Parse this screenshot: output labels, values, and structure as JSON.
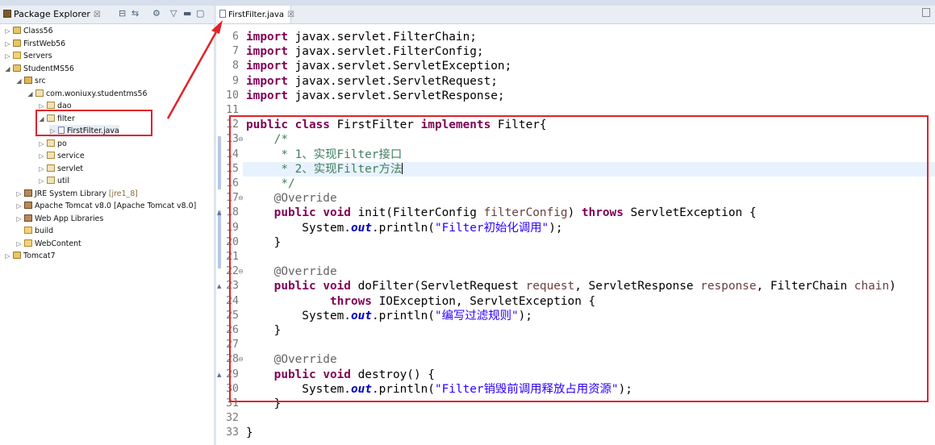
{
  "package_explorer": {
    "title": "Package Explorer",
    "close": "☒",
    "tree": [
      {
        "label": "Class56",
        "icon": "project-icon",
        "twisty": "▷",
        "indent": 0
      },
      {
        "label": "FirstWeb56",
        "icon": "project-icon",
        "twisty": "▷",
        "indent": 0
      },
      {
        "label": "Servers",
        "icon": "folder-icon",
        "twisty": "▷",
        "indent": 0
      },
      {
        "label": "StudentMS56",
        "icon": "project-icon",
        "twisty": "◢",
        "indent": 0
      },
      {
        "label": "src",
        "icon": "source-folder-icon",
        "twisty": "◢",
        "indent": 1
      },
      {
        "label": "com.woniuxy.studentms56",
        "icon": "package-icon",
        "twisty": "◢",
        "indent": 2
      },
      {
        "label": "dao",
        "icon": "package-icon",
        "twisty": "▷",
        "indent": 3
      },
      {
        "label": "filter",
        "icon": "package-icon",
        "twisty": "◢",
        "indent": 3
      },
      {
        "label": "FirstFilter.java",
        "icon": "java-file-icon",
        "twisty": "▷",
        "indent": 4
      },
      {
        "label": "po",
        "icon": "package-icon",
        "twisty": "▷",
        "indent": 3
      },
      {
        "label": "service",
        "icon": "package-icon",
        "twisty": "▷",
        "indent": 3
      },
      {
        "label": "servlet",
        "icon": "package-icon",
        "twisty": "▷",
        "indent": 3
      },
      {
        "label": "util",
        "icon": "package-icon",
        "twisty": "▷",
        "indent": 3
      },
      {
        "label": "JRE System Library",
        "suffix": "[jre1_8]",
        "icon": "library-icon",
        "twisty": "▷",
        "indent": 1
      },
      {
        "label": "Apache Tomcat v8.0 [Apache Tomcat v8.0]",
        "icon": "library-icon",
        "twisty": "▷",
        "indent": 1
      },
      {
        "label": "Web App Libraries",
        "icon": "library-icon",
        "twisty": "▷",
        "indent": 1
      },
      {
        "label": "build",
        "icon": "folder-icon",
        "twisty": "",
        "indent": 1
      },
      {
        "label": "WebContent",
        "icon": "folder-icon",
        "twisty": "▷",
        "indent": 1
      },
      {
        "label": "Tomcat7",
        "icon": "project-icon",
        "twisty": "▷",
        "indent": 0
      }
    ]
  },
  "editor": {
    "tab_label": "FirstFilter.java",
    "tab_close": "☒",
    "lines": [
      {
        "n": "6",
        "segs": [
          {
            "t": "import",
            "c": "kw"
          },
          {
            "t": " javax.servlet.FilterChain;"
          }
        ]
      },
      {
        "n": "7",
        "segs": [
          {
            "t": "import",
            "c": "kw"
          },
          {
            "t": " javax.servlet.FilterConfig;"
          }
        ]
      },
      {
        "n": "8",
        "segs": [
          {
            "t": "import",
            "c": "kw"
          },
          {
            "t": " javax.servlet.ServletException;"
          }
        ]
      },
      {
        "n": "9",
        "segs": [
          {
            "t": "import",
            "c": "kw"
          },
          {
            "t": " javax.servlet.ServletRequest;"
          }
        ]
      },
      {
        "n": "10",
        "segs": [
          {
            "t": "import",
            "c": "kw"
          },
          {
            "t": " javax.servlet.ServletResponse;"
          }
        ]
      },
      {
        "n": "11",
        "segs": []
      },
      {
        "n": "12",
        "segs": [
          {
            "t": "public",
            "c": "kw"
          },
          {
            "t": " "
          },
          {
            "t": "class",
            "c": "kw"
          },
          {
            "t": " FirstFilter "
          },
          {
            "t": "implements",
            "c": "kw"
          },
          {
            "t": " Filter{"
          }
        ]
      },
      {
        "n": "13",
        "fold": "⊖",
        "segs": [
          {
            "t": "    /*",
            "c": "cm"
          }
        ]
      },
      {
        "n": "14",
        "segs": [
          {
            "t": "     * 1、实现Filter接口",
            "c": "cm"
          }
        ]
      },
      {
        "n": "15",
        "segs": [
          {
            "t": "     * 2、实现Filter方法",
            "c": "cm"
          }
        ]
      },
      {
        "n": "16",
        "segs": [
          {
            "t": "     */",
            "c": "cm"
          }
        ]
      },
      {
        "n": "17",
        "fold": "⊖",
        "segs": [
          {
            "t": "    "
          },
          {
            "t": "@Override",
            "c": "an"
          }
        ]
      },
      {
        "n": "18",
        "ovr": "▲",
        "segs": [
          {
            "t": "    "
          },
          {
            "t": "public",
            "c": "kw"
          },
          {
            "t": " "
          },
          {
            "t": "void",
            "c": "kw"
          },
          {
            "t": " init(FilterConfig "
          },
          {
            "t": "filterConfig",
            "c": "param"
          },
          {
            "t": ") "
          },
          {
            "t": "throws",
            "c": "kw"
          },
          {
            "t": " ServletException {"
          }
        ]
      },
      {
        "n": "19",
        "segs": [
          {
            "t": "        System."
          },
          {
            "t": "out",
            "c": "sf"
          },
          {
            "t": ".println("
          },
          {
            "t": "\"Filter初始化调用\"",
            "c": "str"
          },
          {
            "t": ");"
          }
        ]
      },
      {
        "n": "20",
        "segs": [
          {
            "t": "    }"
          }
        ]
      },
      {
        "n": "21",
        "segs": []
      },
      {
        "n": "22",
        "fold": "⊖",
        "segs": [
          {
            "t": "    "
          },
          {
            "t": "@Override",
            "c": "an"
          }
        ]
      },
      {
        "n": "23",
        "ovr": "▲",
        "segs": [
          {
            "t": "    "
          },
          {
            "t": "public",
            "c": "kw"
          },
          {
            "t": " "
          },
          {
            "t": "void",
            "c": "kw"
          },
          {
            "t": " doFilter(ServletRequest "
          },
          {
            "t": "request",
            "c": "param"
          },
          {
            "t": ", ServletResponse "
          },
          {
            "t": "response",
            "c": "param"
          },
          {
            "t": ", FilterChain "
          },
          {
            "t": "chain",
            "c": "param"
          },
          {
            "t": ")"
          }
        ]
      },
      {
        "n": "24",
        "segs": [
          {
            "t": "            "
          },
          {
            "t": "throws",
            "c": "kw"
          },
          {
            "t": " IOException, ServletException {"
          }
        ]
      },
      {
        "n": "25",
        "segs": [
          {
            "t": "        System."
          },
          {
            "t": "out",
            "c": "sf"
          },
          {
            "t": ".println("
          },
          {
            "t": "\"编写过滤规则\"",
            "c": "str"
          },
          {
            "t": ");"
          }
        ]
      },
      {
        "n": "26",
        "segs": [
          {
            "t": "    }"
          }
        ]
      },
      {
        "n": "27",
        "segs": []
      },
      {
        "n": "28",
        "fold": "⊖",
        "segs": [
          {
            "t": "    "
          },
          {
            "t": "@Override",
            "c": "an"
          }
        ]
      },
      {
        "n": "29",
        "ovr": "▲",
        "segs": [
          {
            "t": "    "
          },
          {
            "t": "public",
            "c": "kw"
          },
          {
            "t": " "
          },
          {
            "t": "void",
            "c": "kw"
          },
          {
            "t": " destroy() {"
          }
        ]
      },
      {
        "n": "30",
        "segs": [
          {
            "t": "        System."
          },
          {
            "t": "out",
            "c": "sf"
          },
          {
            "t": ".println("
          },
          {
            "t": "\"Filter销毁前调用释放占用资源\"",
            "c": "str"
          },
          {
            "t": ");"
          }
        ]
      },
      {
        "n": "31",
        "segs": [
          {
            "t": "    }"
          }
        ]
      },
      {
        "n": "32",
        "segs": []
      },
      {
        "n": "33",
        "segs": [
          {
            "t": "}"
          }
        ]
      }
    ]
  },
  "annotation_color": "#e0222a"
}
